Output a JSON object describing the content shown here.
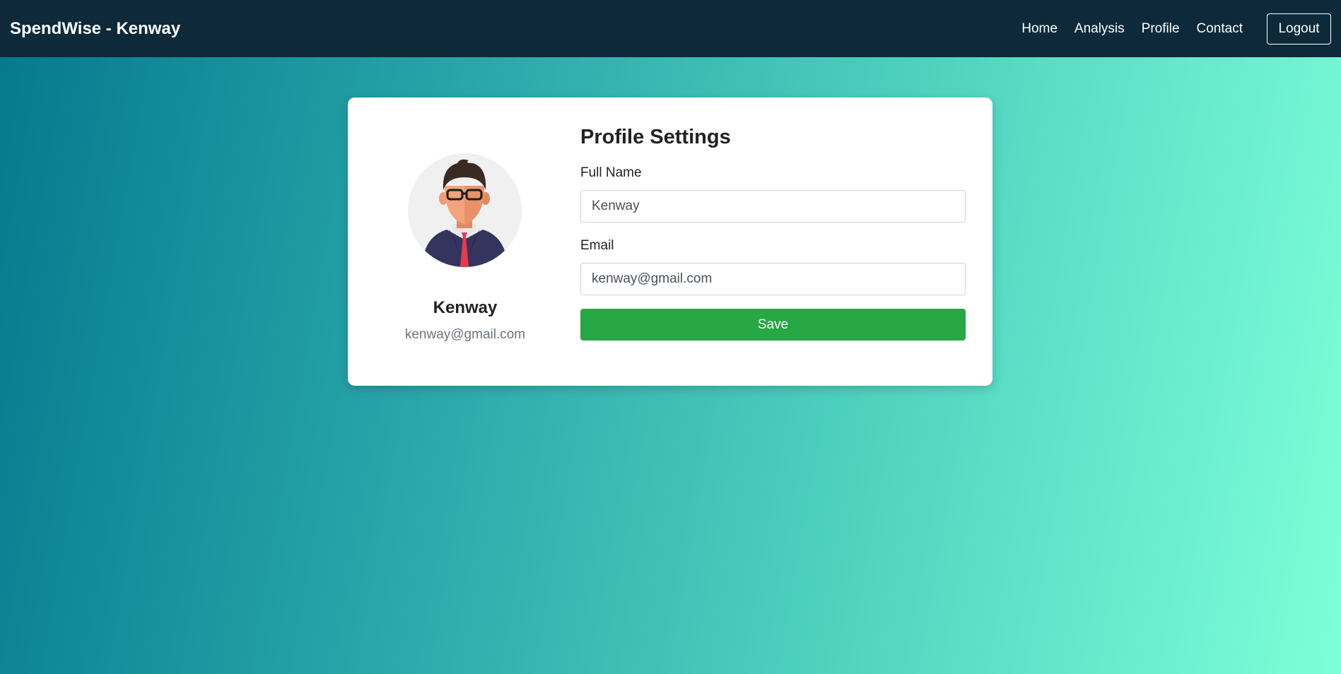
{
  "navbar": {
    "brand": "SpendWise - Kenway",
    "links": [
      "Home",
      "Analysis",
      "Profile",
      "Contact"
    ],
    "logout_label": "Logout"
  },
  "profile": {
    "name": "Kenway",
    "email": "kenway@gmail.com"
  },
  "settings": {
    "title": "Profile Settings",
    "full_name_label": "Full Name",
    "full_name_value": "Kenway",
    "email_label": "Email",
    "email_value": "kenway@gmail.com",
    "save_label": "Save"
  },
  "colors": {
    "navbar_bg": "#0e2a3a",
    "save_button": "#28a745",
    "gradient_start": "#05788e",
    "gradient_end": "#7dffd9"
  }
}
